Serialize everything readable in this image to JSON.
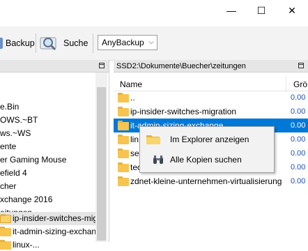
{
  "window": {
    "minimize_glyph": "—",
    "maximize_glyph": "☐",
    "close_glyph": "✕"
  },
  "toolbar": {
    "backup_label": "Backup",
    "search_label": "Suche",
    "profile_value": "AnyBackup"
  },
  "tree": {
    "items": [
      {
        "label": "e.Bin"
      },
      {
        "label": "OWS.~BT"
      },
      {
        "label": "ws.~WS"
      },
      {
        "label": "ente"
      },
      {
        "label": "er Gaming Mouse"
      },
      {
        "label": "efield 4"
      },
      {
        "label": "cher"
      },
      {
        "label": "xchange 2016"
      },
      {
        "label": "eitungen"
      },
      {
        "label": "ip-insider-switches-mig"
      },
      {
        "label": "it-admin-sizing-exchang"
      },
      {
        "label": "linux-..."
      }
    ]
  },
  "right_panel": {
    "path": "SSD2:\\Dokumente\\Buecher\\zeitungen",
    "columns": {
      "name": "Name",
      "size": "Grö"
    },
    "rows": [
      {
        "name": "..",
        "size": "0.00"
      },
      {
        "name": "ip-insider-switches-migration",
        "size": "0.00"
      },
      {
        "name": "it-admin-sizing-exchange",
        "size": "0.00"
      },
      {
        "name": "lin",
        "size": "0.00"
      },
      {
        "name": "sec",
        "size": "0.00"
      },
      {
        "name": "tec",
        "size": "0.00"
      },
      {
        "name": "zdnet-kleine-unternehmen-virtualisierung",
        "size": "0.00"
      }
    ]
  },
  "context_menu": {
    "items": [
      {
        "label": "Im Explorer anzeigen",
        "icon": "folder-icon"
      },
      {
        "label": "Alle Kopien suchen",
        "icon": "binoculars-icon"
      }
    ]
  },
  "colors": {
    "selection": "#0078d7",
    "size_text": "#1f4eb5",
    "folder": "#f6c44f"
  }
}
